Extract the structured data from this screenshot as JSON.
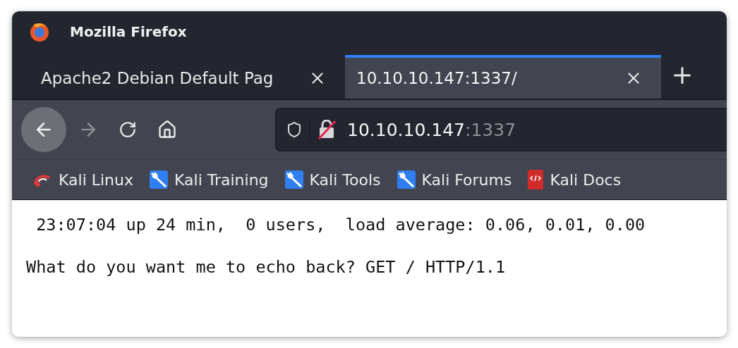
{
  "window": {
    "title": "Mozilla Firefox"
  },
  "tabs": [
    {
      "label": "Apache2 Debian Default Pag",
      "selected": false
    },
    {
      "label": "10.10.10.147:1337/",
      "selected": true
    }
  ],
  "nav_buttons": [
    {
      "kind": "back",
      "disabled": false
    },
    {
      "kind": "forward",
      "disabled": true
    },
    {
      "kind": "reload",
      "disabled": false
    },
    {
      "kind": "home",
      "disabled": false
    }
  ],
  "address_bar": {
    "host": "10.10.10.147",
    "port": ":1337",
    "secure": false
  },
  "bookmarks": [
    {
      "label": "Kali Linux",
      "kind": "kali"
    },
    {
      "label": "Kali Training",
      "kind": "tool"
    },
    {
      "label": "Kali Tools",
      "kind": "tool"
    },
    {
      "label": "Kali Forums",
      "kind": "tool"
    },
    {
      "label": "Kali Docs",
      "kind": "docs"
    }
  ],
  "content": {
    "lines": [
      " 23:07:04 up 24 min,  0 users,  load average: 0.06, 0.01, 0.00",
      "What do you want me to echo back? GET / HTTP/1.1"
    ]
  }
}
